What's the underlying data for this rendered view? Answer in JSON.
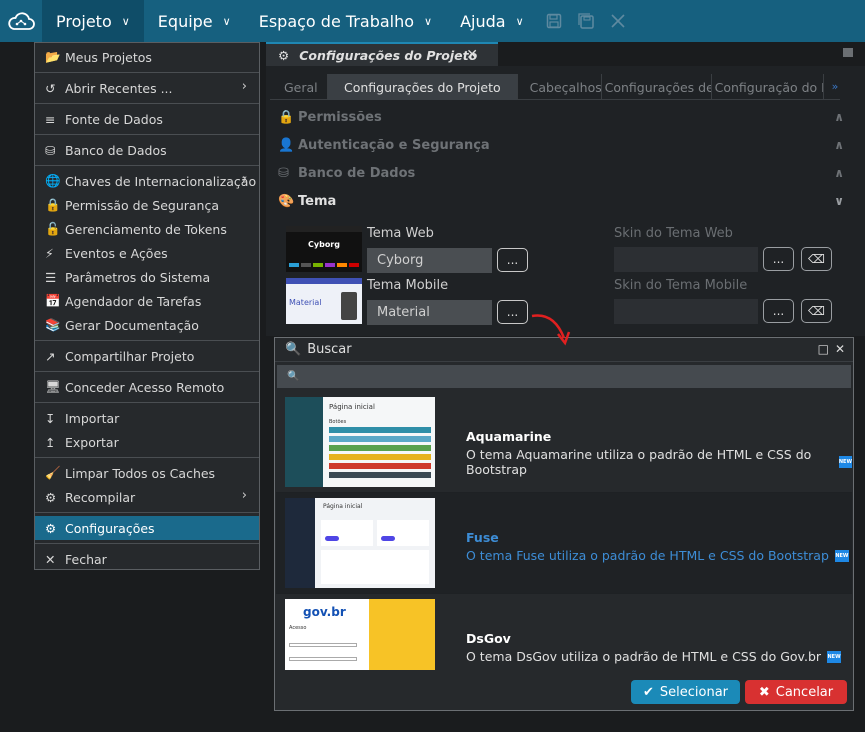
{
  "menubar": {
    "items": [
      {
        "label": "Projeto",
        "active": true
      },
      {
        "label": "Equipe"
      },
      {
        "label": "Espaço de Trabalho"
      },
      {
        "label": "Ajuda"
      }
    ]
  },
  "dropdown": {
    "items": [
      {
        "label": "Meus Projetos",
        "icon": "folder-open-icon"
      },
      {
        "label": "Abrir Recentes ...",
        "icon": "history-icon",
        "submenu": true
      },
      {
        "label": "Fonte de Dados",
        "icon": "data-source-icon"
      },
      {
        "label": "Banco de Dados",
        "icon": "database-icon"
      },
      {
        "label": "Chaves de Internacionalização",
        "icon": "translate-icon",
        "submenu": true
      },
      {
        "label": "Permissão de Segurança",
        "icon": "lock-icon"
      },
      {
        "label": "Gerenciamento de Tokens",
        "icon": "token-lock-icon"
      },
      {
        "label": "Eventos e Ações",
        "icon": "lightning-icon"
      },
      {
        "label": "Parâmetros do Sistema",
        "icon": "sliders-icon"
      },
      {
        "label": "Agendador de Tarefas",
        "icon": "calendar-icon"
      },
      {
        "label": "Gerar Documentação",
        "icon": "books-icon"
      },
      {
        "label": "Compartilhar Projeto",
        "icon": "share-icon"
      },
      {
        "label": "Conceder Acesso Remoto",
        "icon": "remote-icon"
      },
      {
        "label": "Importar",
        "icon": "import-icon"
      },
      {
        "label": "Exportar",
        "icon": "export-icon"
      },
      {
        "label": "Limpar Todos os Caches",
        "icon": "broom-icon"
      },
      {
        "label": "Recompilar",
        "icon": "gears-icon",
        "submenu": true
      },
      {
        "label": "Configurações",
        "icon": "gear-icon",
        "selected": true
      },
      {
        "label": "Fechar",
        "icon": "close-icon"
      }
    ]
  },
  "document_tab": {
    "label": "Configurações do Projeto"
  },
  "subtabs": [
    "Geral",
    "Configurações do Projeto",
    "Cabeçalhos",
    "Configurações de ...",
    "Configuração do P...",
    "»"
  ],
  "sections": [
    {
      "label": "Permissões",
      "icon": "lock-icon"
    },
    {
      "label": "Autenticação e Segurança",
      "icon": "user-icon"
    },
    {
      "label": "Banco de Dados",
      "icon": "database-icon"
    },
    {
      "label": "Tema",
      "icon": "palette-icon",
      "open": true
    }
  ],
  "theme": {
    "web_label": "Tema Web",
    "web_value": "Cyborg",
    "mobile_label": "Tema Mobile",
    "mobile_value": "Material",
    "skin_web_label": "Skin do Tema Web",
    "skin_mobile_label": "Skin do Tema Mobile",
    "dots": "...",
    "thumb_web_text": "Cyborg",
    "thumb_mobile_text": "Material"
  },
  "modal": {
    "title": "Buscar",
    "items": [
      {
        "title": "Aquamarine",
        "desc": "O tema Aquamarine utiliza o padrão de HTML e CSS do Bootstrap",
        "thumb_title": "Página inicial",
        "thumb_sub": "Botões"
      },
      {
        "title": "Fuse",
        "desc": "O tema Fuse utiliza o padrão de HTML e CSS do Bootstrap",
        "highlight": true,
        "thumb_title": "Página inicial"
      },
      {
        "title": "DsGov",
        "desc": "O tema DsGov utiliza o padrão de HTML e CSS do Gov.br",
        "thumb_title": "gov.br",
        "thumb_sub": "Acesso"
      }
    ],
    "badge": "NEW",
    "select_label": "Selecionar",
    "cancel_label": "Cancelar"
  },
  "colors": {
    "topbar": "#16607f",
    "accent": "#1b8ab8",
    "danger": "#d83131",
    "selected": "#1a6a8c"
  }
}
